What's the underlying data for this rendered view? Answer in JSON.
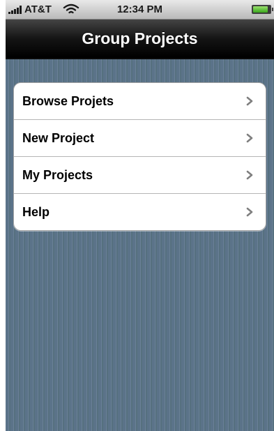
{
  "status_bar": {
    "carrier": "AT&T",
    "time": "12:34 PM",
    "battery_level": 0.9,
    "signal_icon": "signal-bars-icon",
    "wifi_icon": "wifi-icon",
    "battery_icon": "battery-icon"
  },
  "nav": {
    "title": "Group Projects"
  },
  "menu": {
    "items": [
      {
        "label": "Browse Projets",
        "icon": "chevron-right-icon"
      },
      {
        "label": "New Project",
        "icon": "chevron-right-icon"
      },
      {
        "label": "My Projects",
        "icon": "chevron-right-icon"
      },
      {
        "label": "Help",
        "icon": "chevron-right-icon"
      }
    ]
  },
  "colors": {
    "background": "#5d7590",
    "nav_bar": "#141414",
    "status_bar": "#d0d0d0",
    "battery_green": "#39a71c",
    "chevron": "#7f7f7f"
  }
}
